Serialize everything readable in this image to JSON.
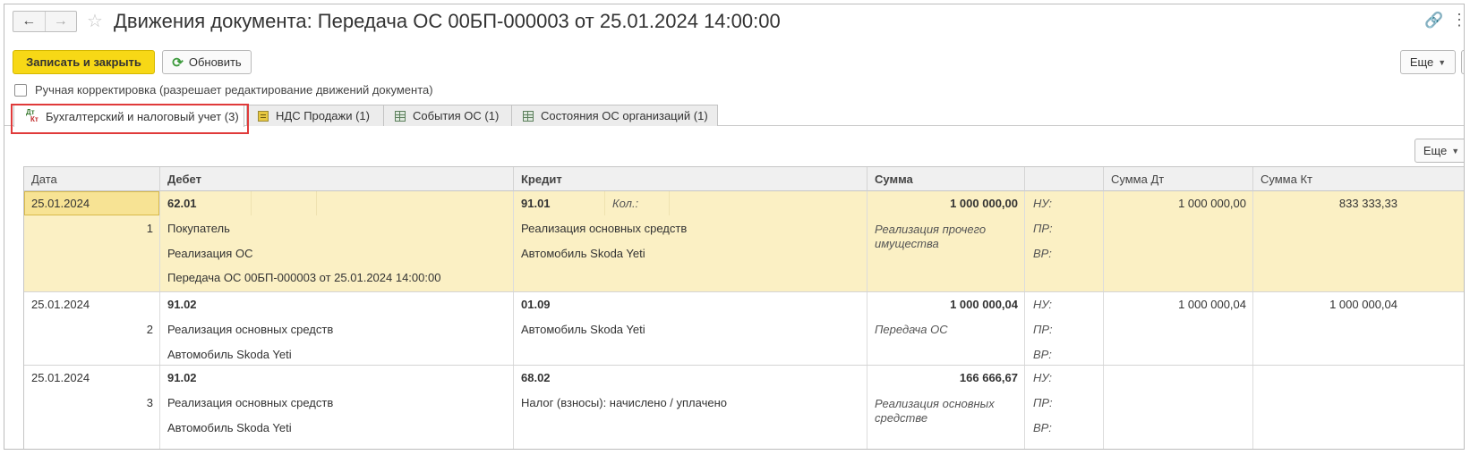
{
  "window": {
    "title": "Движения документа: Передача ОС 00БП-000003 от 25.01.2024 14:00:00"
  },
  "toolbar": {
    "save_close_label": "Записать и закрыть",
    "refresh_label": "Обновить",
    "more_label": "Еще"
  },
  "manual_edit": {
    "label": "Ручная корректировка (разрешает редактирование движений документа)",
    "checked": false
  },
  "tabs": [
    {
      "label": "Бухгалтерский и налоговый учет (3)",
      "icon": "dt-kt-icon",
      "active": true
    },
    {
      "label": "НДС Продажи (1)",
      "icon": "register-icon",
      "active": false
    },
    {
      "label": "События ОС (1)",
      "icon": "table-icon",
      "active": false
    },
    {
      "label": "Состояния ОС организаций (1)",
      "icon": "table-icon",
      "active": false
    }
  ],
  "table": {
    "more_label": "Еще",
    "columns": [
      "Дата",
      "Дебет",
      "Кредит",
      "Сумма",
      "",
      "Сумма Дт",
      "Сумма Кт"
    ],
    "rows": [
      {
        "date": "25.01.2024",
        "num": "1",
        "debit": [
          "62.01",
          "Покупатель",
          "Реализация ОС",
          "Передача ОС 00БП-000003 от 25.01.2024 14:00:00"
        ],
        "credit": [
          "91.01",
          "Реализация основных средств",
          "Автомобиль Skoda Yeti"
        ],
        "credit_qty_label": "Кол.:",
        "sum": "1 000 000,00",
        "content": "Реализация прочего имущества",
        "nu_label": "НУ:",
        "pr_label": "ПР:",
        "vr_label": "ВР:",
        "sum_dt": "1 000 000,00",
        "sum_kt": "833 333,33"
      },
      {
        "date": "25.01.2024",
        "num": "2",
        "debit": [
          "91.02",
          "Реализация основных средств",
          "Автомобиль Skoda Yeti"
        ],
        "credit": [
          "01.09",
          "Автомобиль Skoda Yeti"
        ],
        "sum": "1 000 000,04",
        "content": "Передача ОС",
        "nu_label": "НУ:",
        "pr_label": "ПР:",
        "vr_label": "ВР:",
        "sum_dt": "1 000 000,04",
        "sum_kt": "1 000 000,04"
      },
      {
        "date": "25.01.2024",
        "num": "3",
        "debit": [
          "91.02",
          "Реализация основных средств",
          "Автомобиль Skoda Yeti"
        ],
        "credit": [
          "68.02",
          "Налог (взносы): начислено / уплачено"
        ],
        "sum": "166 666,67",
        "content": "Реализация основных средстве",
        "nu_label": "НУ:",
        "pr_label": "ПР:",
        "vr_label": "ВР:",
        "sum_dt": "",
        "sum_kt": ""
      }
    ]
  }
}
